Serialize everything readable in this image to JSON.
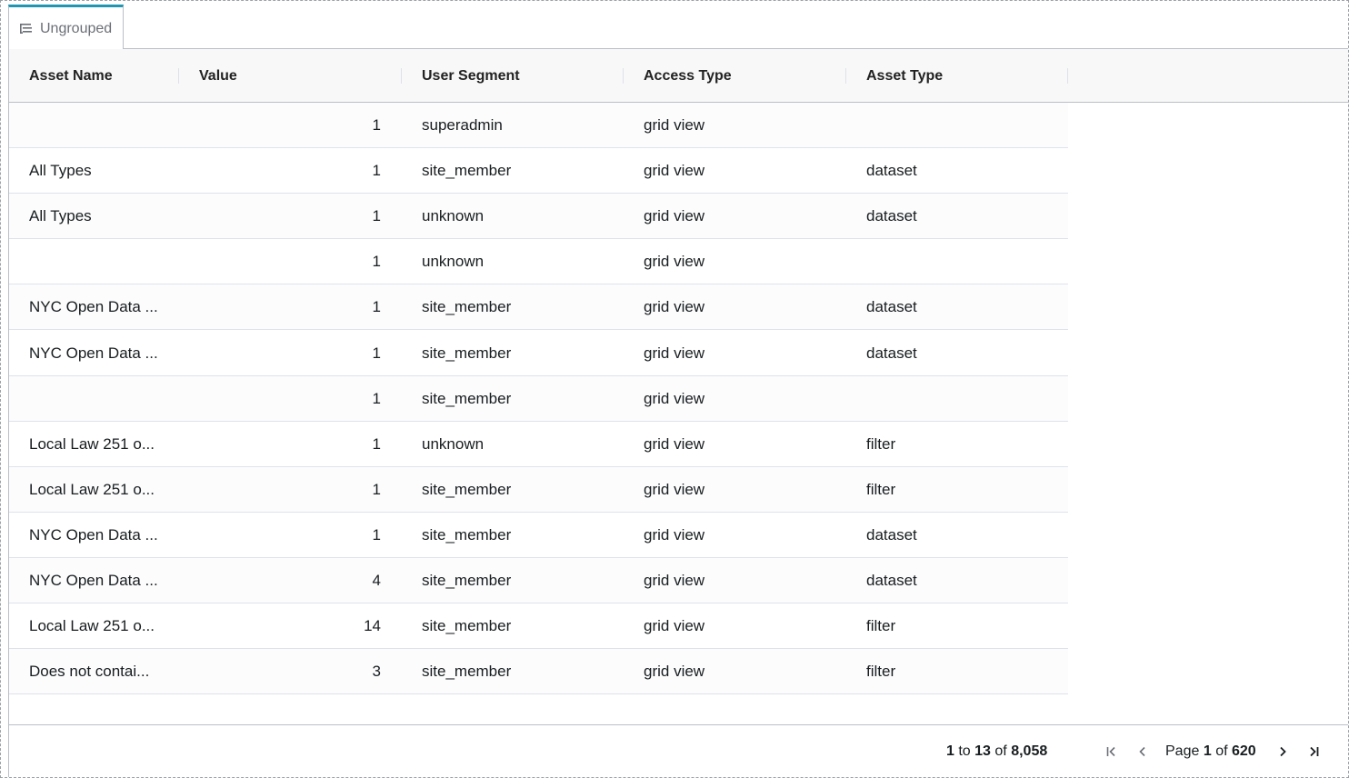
{
  "tab": {
    "label": "Ungrouped",
    "icon": "list-tree-icon",
    "accent_color": "#2196b3"
  },
  "columns": [
    "Asset Name",
    "Value",
    "User Segment",
    "Access Type",
    "Asset Type"
  ],
  "rows": [
    {
      "asset_name": "",
      "value": "1",
      "user_segment": "superadmin",
      "access_type": "grid view",
      "asset_type": ""
    },
    {
      "asset_name": "All Types",
      "value": "1",
      "user_segment": "site_member",
      "access_type": "grid view",
      "asset_type": "dataset"
    },
    {
      "asset_name": "All Types",
      "value": "1",
      "user_segment": "unknown",
      "access_type": "grid view",
      "asset_type": "dataset"
    },
    {
      "asset_name": "",
      "value": "1",
      "user_segment": "unknown",
      "access_type": "grid view",
      "asset_type": ""
    },
    {
      "asset_name": "NYC Open Data ...",
      "value": "1",
      "user_segment": "site_member",
      "access_type": "grid view",
      "asset_type": "dataset"
    },
    {
      "asset_name": "NYC Open Data ...",
      "value": "1",
      "user_segment": "site_member",
      "access_type": "grid view",
      "asset_type": "dataset"
    },
    {
      "asset_name": "",
      "value": "1",
      "user_segment": "site_member",
      "access_type": "grid view",
      "asset_type": ""
    },
    {
      "asset_name": "Local Law 251 o...",
      "value": "1",
      "user_segment": "unknown",
      "access_type": "grid view",
      "asset_type": "filter"
    },
    {
      "asset_name": "Local Law 251 o...",
      "value": "1",
      "user_segment": "site_member",
      "access_type": "grid view",
      "asset_type": "filter"
    },
    {
      "asset_name": "NYC Open Data ...",
      "value": "1",
      "user_segment": "site_member",
      "access_type": "grid view",
      "asset_type": "dataset"
    },
    {
      "asset_name": "NYC Open Data ...",
      "value": "4",
      "user_segment": "site_member",
      "access_type": "grid view",
      "asset_type": "dataset"
    },
    {
      "asset_name": "Local Law 251 o...",
      "value": "14",
      "user_segment": "site_member",
      "access_type": "grid view",
      "asset_type": "filter"
    },
    {
      "asset_name": "Does not contai...",
      "value": "3",
      "user_segment": "site_member",
      "access_type": "grid view",
      "asset_type": "filter"
    }
  ],
  "pagination": {
    "row_from": "1",
    "to_word": "to",
    "row_to": "13",
    "of_word": "of",
    "row_total": "8,058",
    "page_word": "Page",
    "page_current": "1",
    "page_total": "620",
    "icons": [
      "first-page-icon",
      "previous-page-icon",
      "next-page-icon",
      "last-page-icon"
    ]
  }
}
